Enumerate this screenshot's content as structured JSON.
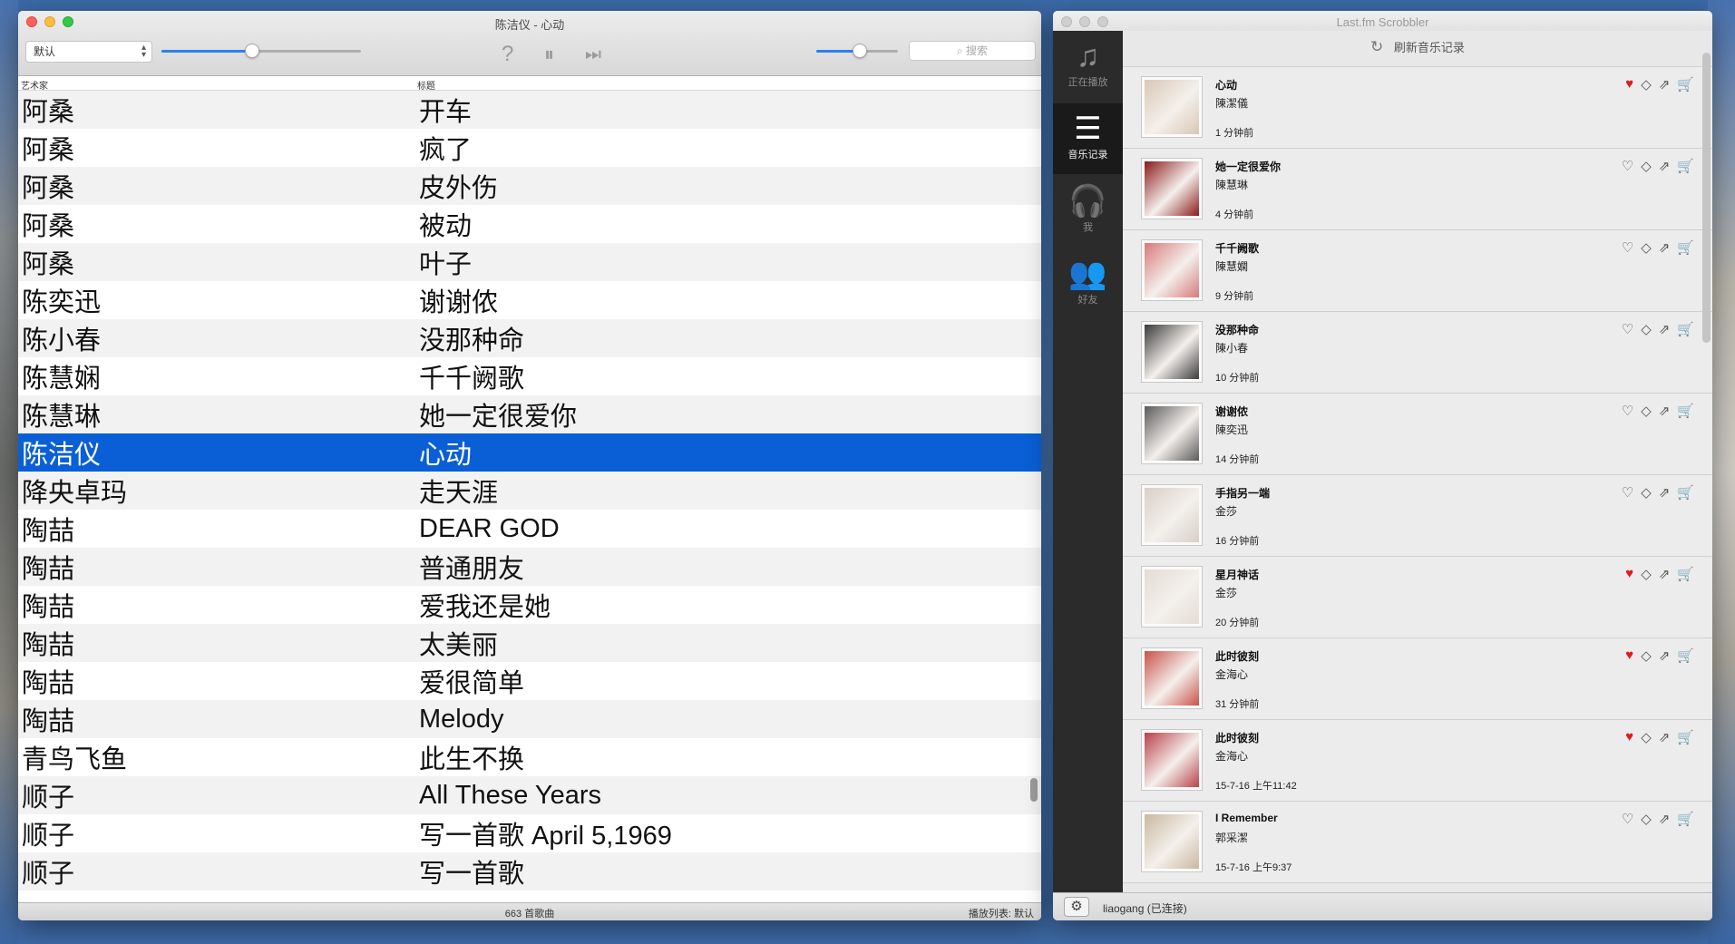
{
  "player": {
    "window_title": "陈洁仪 - 心动",
    "playlist_select": "默认",
    "search_placeholder": "搜索",
    "controls": {
      "help": "?",
      "pause": "⏸",
      "next": "⏭"
    },
    "columns": {
      "artist": "艺术家",
      "title": "标题"
    },
    "rows": [
      {
        "artist": "阿桑",
        "title": "开车"
      },
      {
        "artist": "阿桑",
        "title": "疯了"
      },
      {
        "artist": "阿桑",
        "title": "皮外伤"
      },
      {
        "artist": "阿桑",
        "title": "被动"
      },
      {
        "artist": "阿桑",
        "title": "叶子"
      },
      {
        "artist": "陈奕迅",
        "title": "谢谢侬"
      },
      {
        "artist": "陈小春",
        "title": "没那种命"
      },
      {
        "artist": "陈慧娴",
        "title": "千千阙歌"
      },
      {
        "artist": "陈慧琳",
        "title": "她一定很爱你"
      },
      {
        "artist": "陈洁仪",
        "title": "心动"
      },
      {
        "artist": "降央卓玛",
        "title": "走天涯"
      },
      {
        "artist": "陶喆",
        "title": "DEAR GOD"
      },
      {
        "artist": "陶喆",
        "title": "普通朋友"
      },
      {
        "artist": "陶喆",
        "title": "爱我还是她"
      },
      {
        "artist": "陶喆",
        "title": "太美丽"
      },
      {
        "artist": "陶喆",
        "title": "爱很简单"
      },
      {
        "artist": "陶喆",
        "title": "Melody"
      },
      {
        "artist": "青鸟飞鱼",
        "title": "此生不换"
      },
      {
        "artist": "顺子",
        "title": "All These Years"
      },
      {
        "artist": "顺子",
        "title": "写一首歌 April 5,1969"
      },
      {
        "artist": "顺子",
        "title": "写一首歌"
      }
    ],
    "selected_index": 9,
    "status_count": "663 首歌曲",
    "status_playlist": "播放列表: 默认",
    "accent_color": "#0a5fd6"
  },
  "lastfm": {
    "window_title": "Last.fm Scrobbler",
    "nav": [
      {
        "label": "正在播放",
        "icon": "music-note-icon"
      },
      {
        "label": "音乐记录",
        "icon": "list-icon"
      },
      {
        "label": "我",
        "icon": "headphones-icon"
      },
      {
        "label": "好友",
        "icon": "friends-icon"
      }
    ],
    "refresh_label": "刷新音乐记录",
    "tracks": [
      {
        "title": "心动",
        "artist": "陳潔儀",
        "time": "1 分钟前",
        "loved": true
      },
      {
        "title": "她一定很爱你",
        "artist": "陳慧琳",
        "time": "4 分钟前",
        "loved": false
      },
      {
        "title": "千千阙歌",
        "artist": "陳慧嫻",
        "time": "9 分钟前",
        "loved": false
      },
      {
        "title": "没那种命",
        "artist": "陳小春",
        "time": "10 分钟前",
        "loved": false
      },
      {
        "title": "谢谢侬",
        "artist": "陳奕迅",
        "time": "14 分钟前",
        "loved": false
      },
      {
        "title": "手指另一端",
        "artist": "金莎",
        "time": "16 分钟前",
        "loved": false
      },
      {
        "title": "星月神话",
        "artist": "金莎",
        "time": "20 分钟前",
        "loved": true
      },
      {
        "title": "此时彼刻",
        "artist": "金海心",
        "time": "31 分钟前",
        "loved": true
      },
      {
        "title": "此时彼刻",
        "artist": "金海心",
        "time": "15-7-16 上午11:42",
        "loved": true
      },
      {
        "title": "I Remember",
        "artist": "郭采潔",
        "time": "15-7-16 上午9:37",
        "loved": false
      }
    ],
    "user_status": "liaogang (已连接)",
    "love_color": "#e01a1a"
  }
}
